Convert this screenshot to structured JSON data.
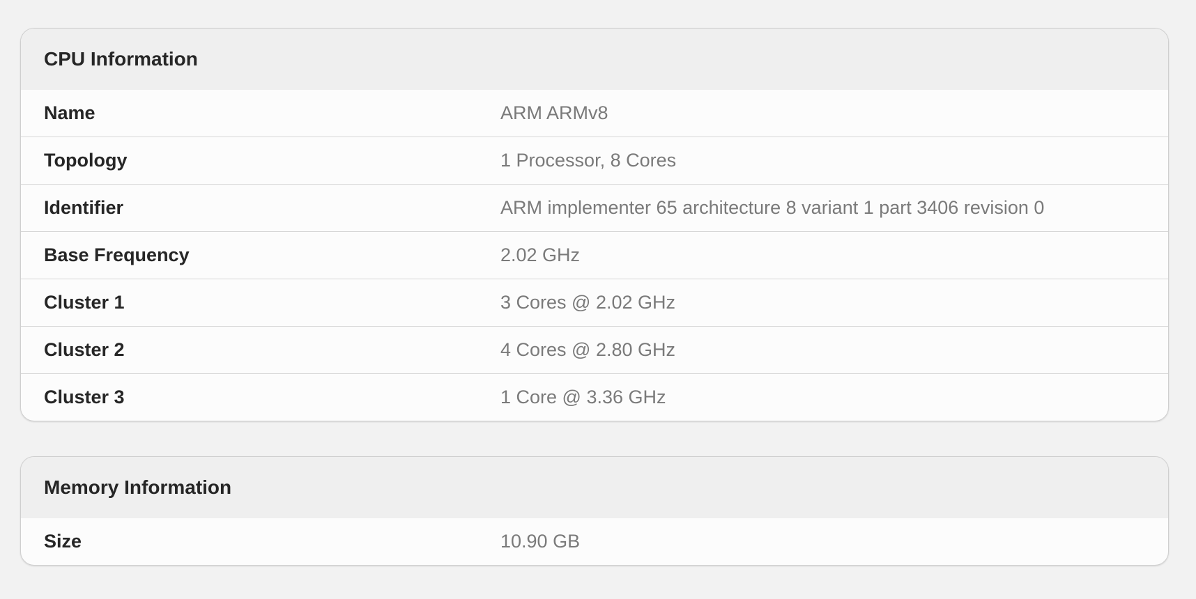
{
  "cpu": {
    "title": "CPU Information",
    "rows": [
      {
        "label": "Name",
        "value": "ARM ARMv8"
      },
      {
        "label": "Topology",
        "value": "1 Processor, 8 Cores"
      },
      {
        "label": "Identifier",
        "value": "ARM implementer 65 architecture 8 variant 1 part 3406 revision 0"
      },
      {
        "label": "Base Frequency",
        "value": "2.02 GHz"
      },
      {
        "label": "Cluster 1",
        "value": "3 Cores @ 2.02 GHz"
      },
      {
        "label": "Cluster 2",
        "value": "4 Cores @ 2.80 GHz"
      },
      {
        "label": "Cluster 3",
        "value": "1 Core @ 3.36 GHz"
      }
    ]
  },
  "memory": {
    "title": "Memory Information",
    "rows": [
      {
        "label": "Size",
        "value": "10.90 GB"
      }
    ]
  }
}
